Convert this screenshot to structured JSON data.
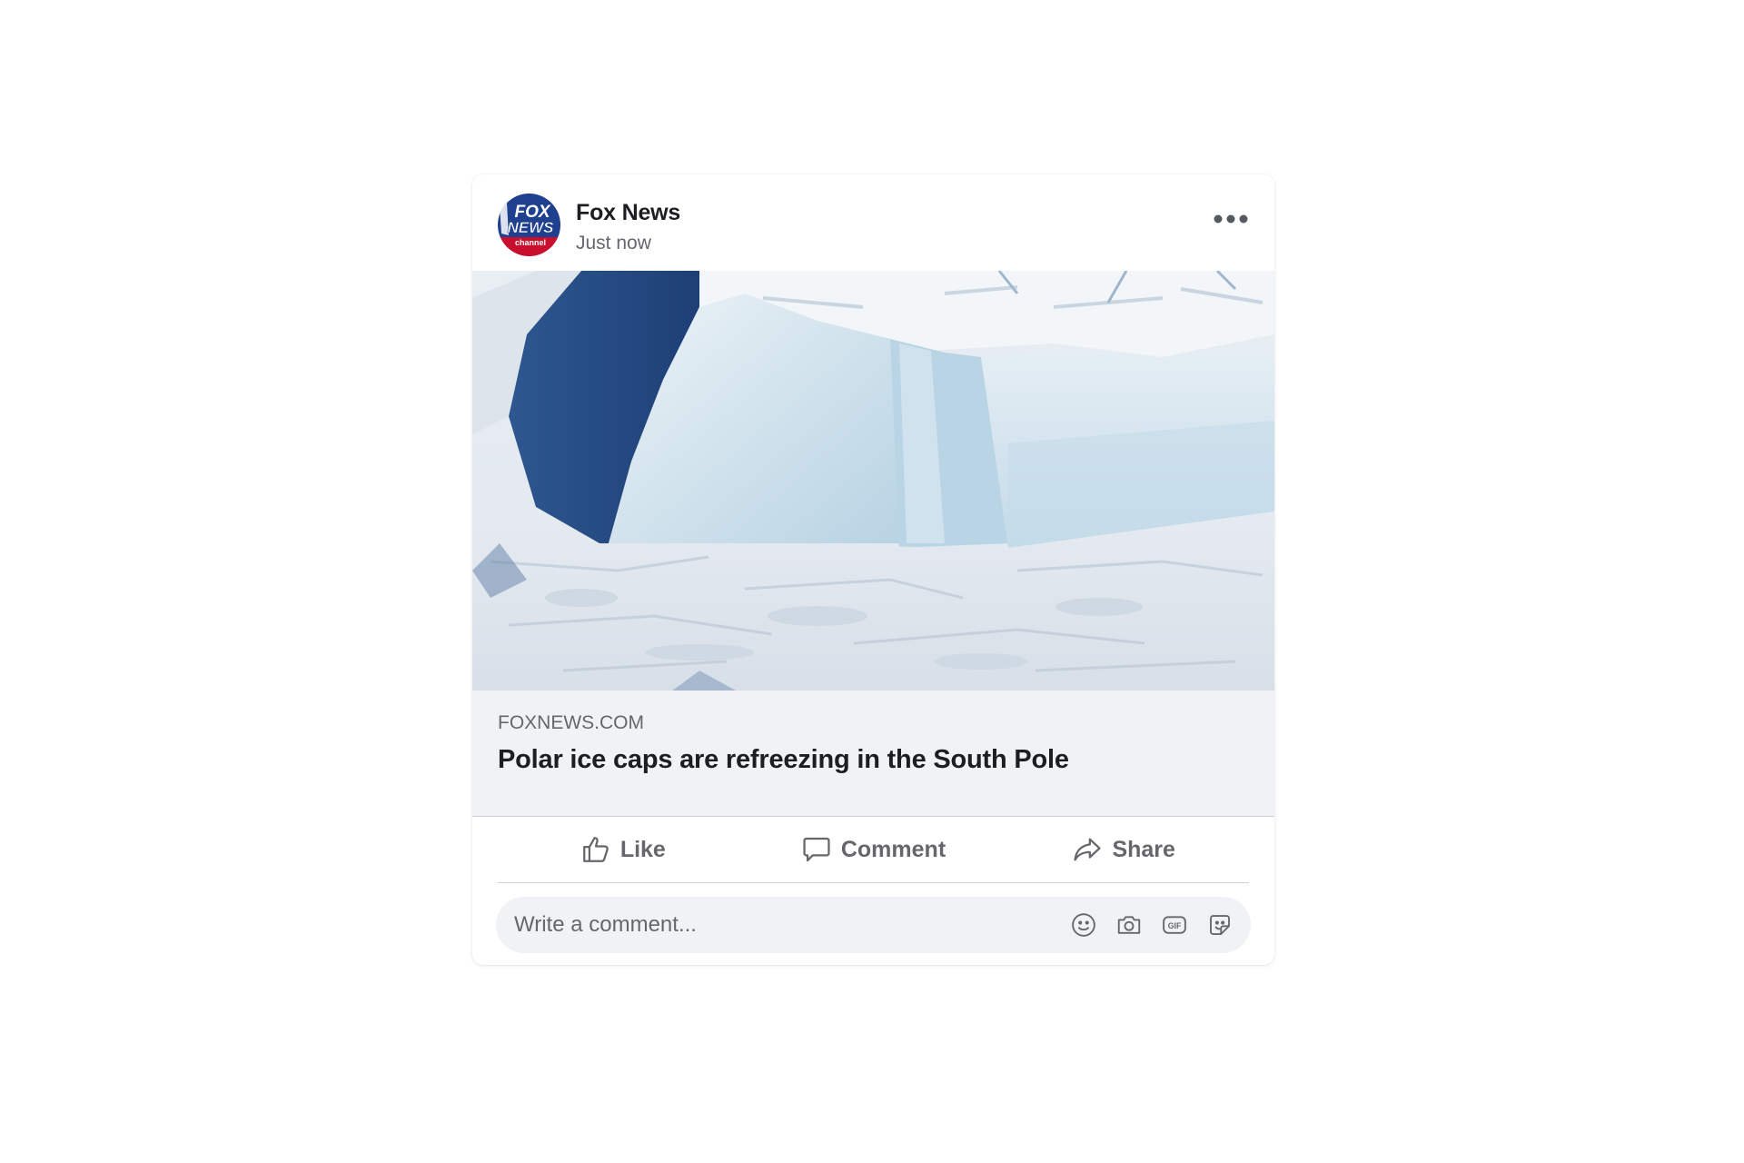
{
  "post": {
    "author": "Fox News",
    "timestamp": "Just now",
    "avatar_logo_text": [
      "FOX",
      "NEWS",
      "channel"
    ],
    "more_icon": "more-horizontal-icon"
  },
  "link": {
    "domain": "FOXNEWS.COM",
    "title": "Polar ice caps are refreezing in the South Pole"
  },
  "actions": {
    "like": "Like",
    "comment": "Comment",
    "share": "Share"
  },
  "comment_box": {
    "placeholder": "Write a comment...",
    "tools": [
      "emoji-icon",
      "camera-icon",
      "gif-icon",
      "sticker-icon"
    ]
  },
  "colors": {
    "text_primary": "#1c1e21",
    "text_secondary": "#65676b",
    "panel_bg": "#f0f2f5",
    "divider": "#ced0d4"
  }
}
